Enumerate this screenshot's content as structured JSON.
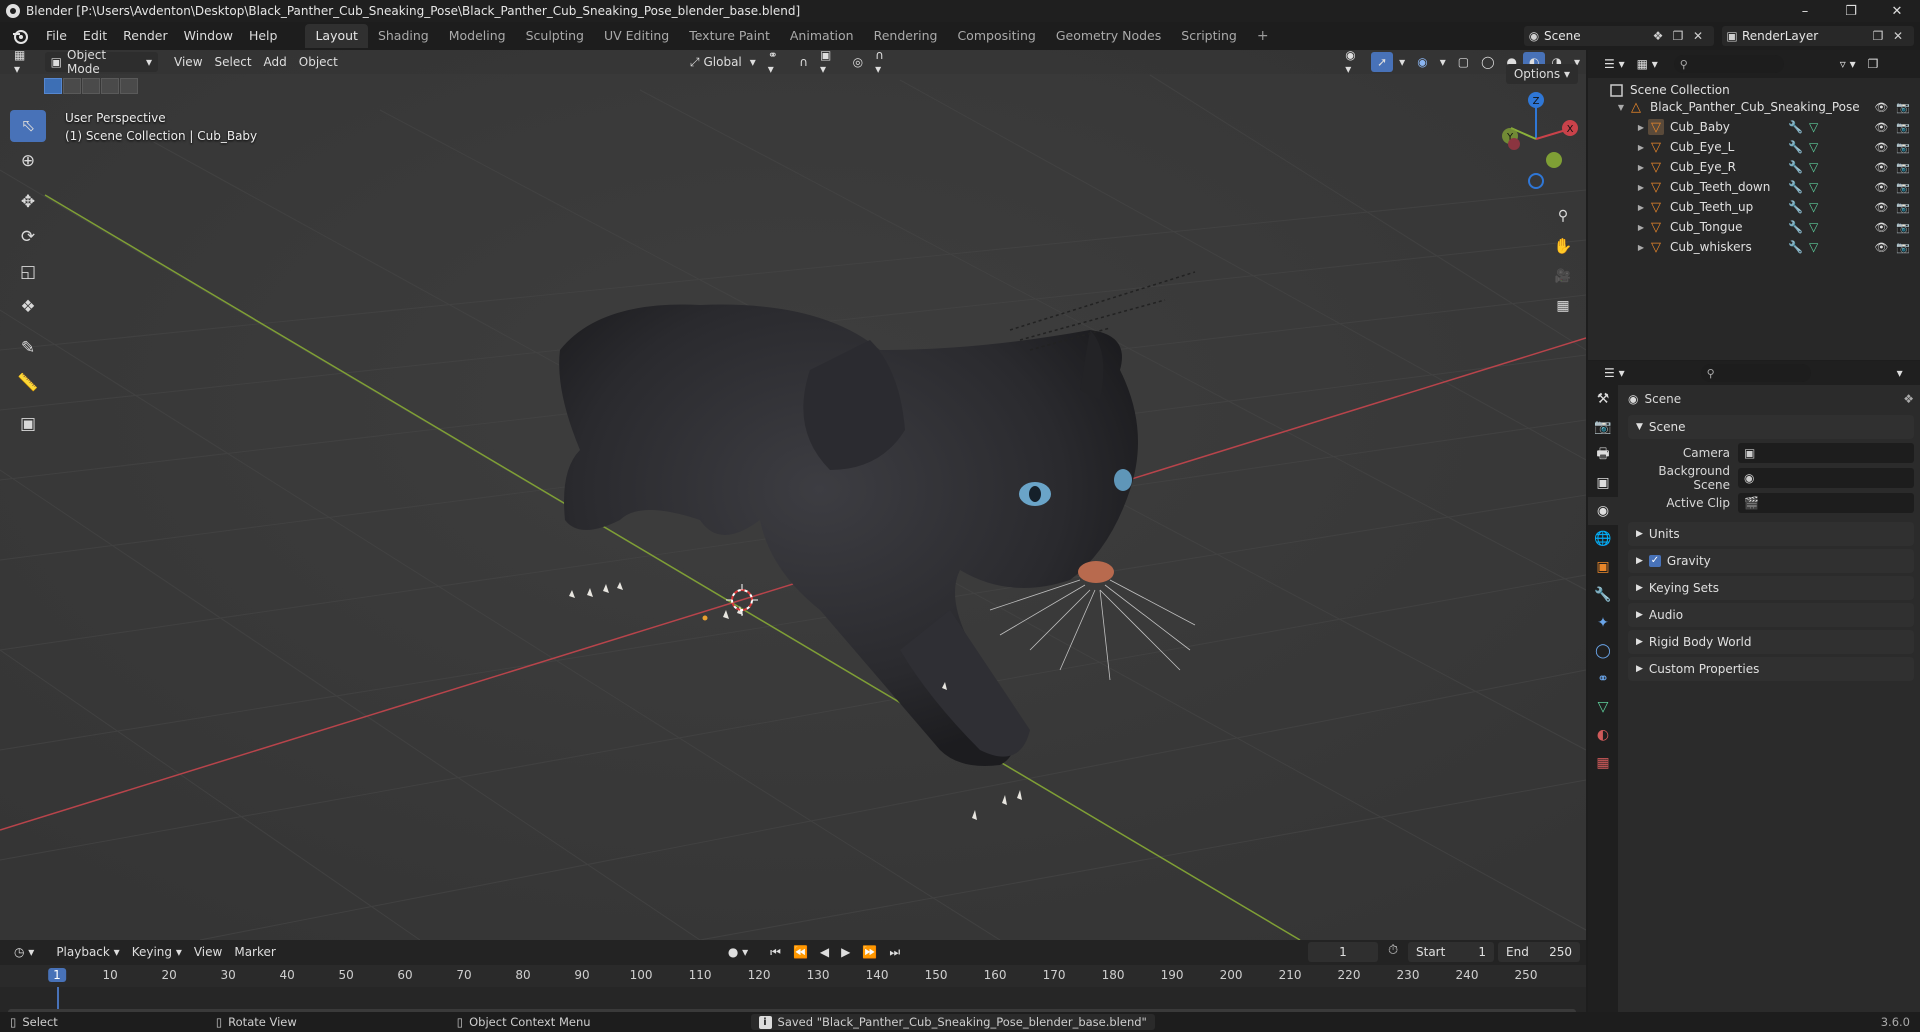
{
  "window": {
    "title": "Blender [P:\\Users\\Avdenton\\Desktop\\Black_Panther_Cub_Sneaking_Pose\\Black_Panther_Cub_Sneaking_Pose_blender_base.blend]",
    "controls": [
      "–",
      "❐",
      "✕"
    ]
  },
  "menu": [
    "File",
    "Edit",
    "Render",
    "Window",
    "Help"
  ],
  "workspaces": [
    "Layout",
    "Shading",
    "Modeling",
    "Sculpting",
    "UV Editing",
    "Texture Paint",
    "Animation",
    "Rendering",
    "Compositing",
    "Geometry Nodes",
    "Scripting"
  ],
  "active_workspace": "Layout",
  "scene_name": "Scene",
  "view_layer": "RenderLayer",
  "viewport": {
    "mode": "Object Mode",
    "menus": [
      "View",
      "Select",
      "Add",
      "Object"
    ],
    "orientation": "Global",
    "options_label": "Options",
    "info_line1": "User Perspective",
    "info_line2": "(1) Scene Collection | Cub_Baby"
  },
  "outliner": {
    "root": "Scene Collection",
    "collection": "Black_Panther_Cub_Sneaking_Pose",
    "objects": [
      "Cub_Baby",
      "Cub_Eye_L",
      "Cub_Eye_R",
      "Cub_Teeth_down",
      "Cub_Teeth_up",
      "Cub_Tongue",
      "Cub_whiskers"
    ]
  },
  "properties": {
    "context_title": "Scene",
    "section_title": "Scene",
    "fields": [
      {
        "label": "Camera",
        "value": ""
      },
      {
        "label": "Background Scene",
        "value": ""
      },
      {
        "label": "Active Clip",
        "value": ""
      }
    ],
    "panels": [
      "Units",
      "Gravity",
      "Keying Sets",
      "Audio",
      "Rigid Body World",
      "Custom Properties"
    ],
    "gravity_checked": true
  },
  "timeline": {
    "menus": [
      "Playback",
      "Keying",
      "View",
      "Marker"
    ],
    "current_frame": "1",
    "start_label": "Start",
    "start": "1",
    "end_label": "End",
    "end": "250",
    "ruler_marks": [
      "1",
      "10",
      "20",
      "30",
      "40",
      "50",
      "60",
      "70",
      "80",
      "90",
      "100",
      "110",
      "120",
      "130",
      "140",
      "150",
      "160",
      "170",
      "180",
      "190",
      "200",
      "210",
      "220",
      "230",
      "240",
      "250"
    ]
  },
  "statusbar": {
    "select": "Select",
    "rotate": "Rotate View",
    "context_menu": "Object Context Menu",
    "message": "Saved \"Black_Panther_Cub_Sneaking_Pose_blender_base.blend\"",
    "version": "3.6.0"
  },
  "colors": {
    "accent": "#4872b8",
    "object_orange": "#e8862a",
    "mesh_green": "#5fce9b",
    "x_axis": "#c9424a",
    "y_axis": "#8bb03a",
    "z_axis": "#2f77d6"
  }
}
